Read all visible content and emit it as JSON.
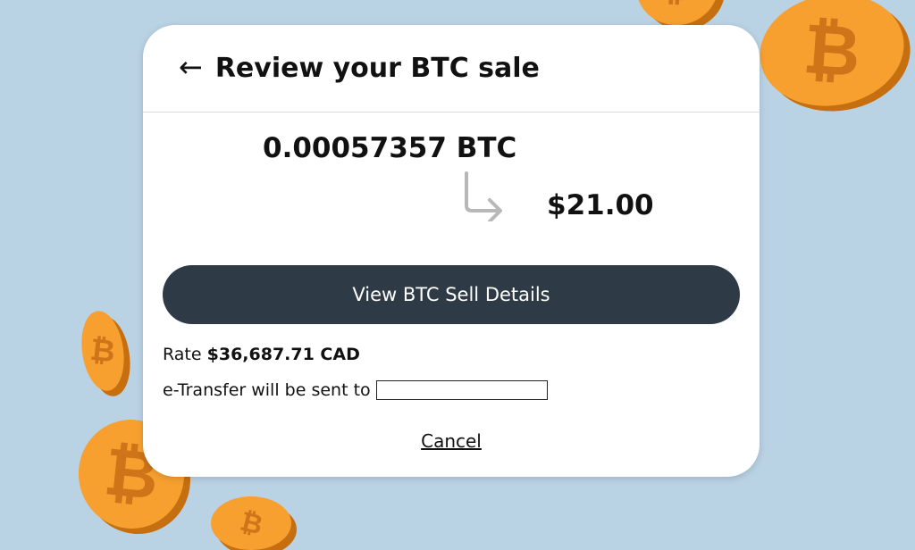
{
  "header": {
    "title": "Review your BTC sale",
    "back_icon": "←"
  },
  "sale": {
    "btc_amount": "0.00057357 BTC",
    "cad_amount": "$21.00"
  },
  "details_button": {
    "label": "View BTC Sell Details"
  },
  "rate": {
    "label": "Rate",
    "value": "$36,687.71 CAD"
  },
  "transfer": {
    "label": "e-Transfer will be sent to",
    "recipient": ""
  },
  "cancel": {
    "label": "Cancel"
  },
  "decoration": {
    "coin_symbol": "₿"
  },
  "colors": {
    "background": "#b9d2e4",
    "button": "#2e3a45",
    "coin": "#f7a030"
  }
}
